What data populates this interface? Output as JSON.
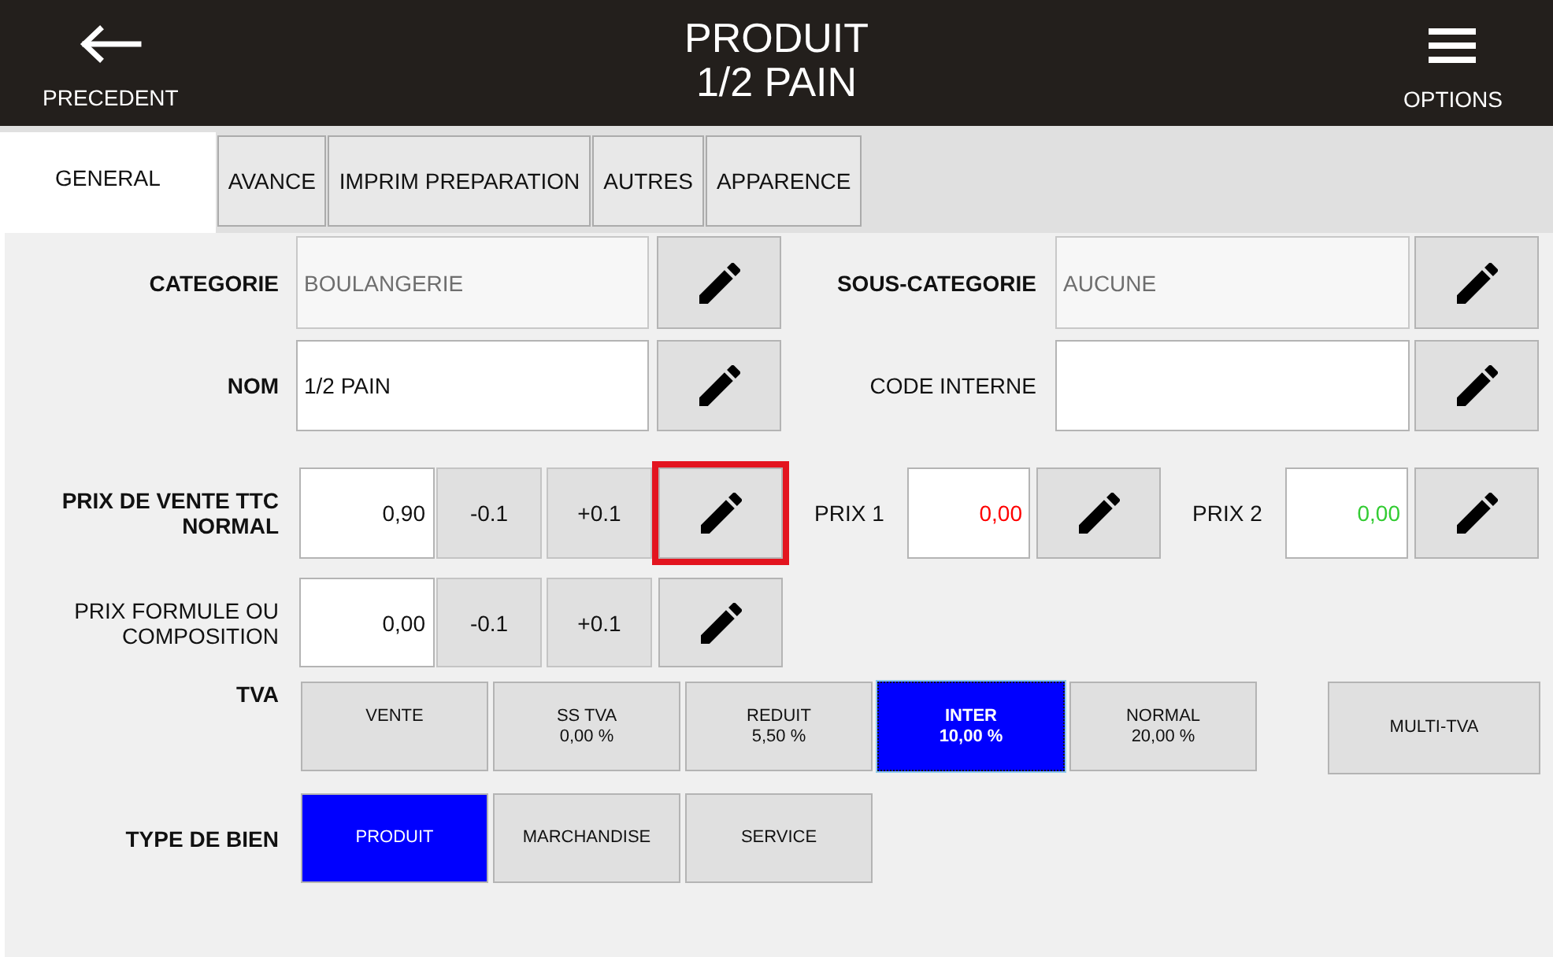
{
  "header": {
    "back_label": "PRECEDENT",
    "title": "PRODUIT",
    "subtitle": "1/2 PAIN",
    "options_label": "OPTIONS"
  },
  "tabs": [
    {
      "label": "GENERAL",
      "selected": true
    },
    {
      "label": "AVANCE",
      "selected": false
    },
    {
      "label": "IMPRIM PREPARATION",
      "selected": false
    },
    {
      "label": "AUTRES",
      "selected": false
    },
    {
      "label": "APPARENCE",
      "selected": false
    }
  ],
  "rows": [
    {
      "kind": "fields",
      "items": [
        {
          "label": "CATEGORIE",
          "bold": true,
          "value": "BOULANGERIE",
          "readonly": true
        },
        {
          "label": "SOUS-CATEGORIE",
          "bold": true,
          "value": "AUCUNE",
          "readonly": true
        }
      ]
    },
    {
      "kind": "fields",
      "items": [
        {
          "label": "NOM",
          "bold": true,
          "value": "1/2 PAIN",
          "readonly": false
        },
        {
          "label": "CODE INTERNE",
          "bold": false,
          "readonly": false
        }
      ]
    },
    {
      "kind": "price",
      "label": "PRIX DE VENTE TTC NORMAL",
      "bold": true,
      "value": "0,90",
      "steps": [
        "-0.1",
        "+0.1"
      ],
      "highlighted": true,
      "extras": [
        {
          "label": "PRIX 1",
          "value": "0,00",
          "color": "#ff0000"
        },
        {
          "label": "PRIX 2",
          "value": "0,00",
          "color": "#33cc33"
        }
      ]
    },
    {
      "kind": "price",
      "label": "PRIX FORMULE OU COMPOSITION",
      "bold": false,
      "value": "0,00",
      "steps": [
        "-0.1",
        "+0.1"
      ],
      "highlighted": false
    },
    {
      "kind": "rates",
      "label": "TVA",
      "bold": true,
      "options": [
        {
          "name": "VENTE",
          "selected": false,
          "focused": false
        },
        {
          "name": "SS TVA",
          "rate": "0,00 %",
          "selected": false,
          "focused": false
        },
        {
          "name": "REDUIT",
          "rate": "5,50 %",
          "selected": false,
          "focused": false
        },
        {
          "name": "INTER",
          "rate": "10,00 %",
          "selected": true,
          "focused": true
        },
        {
          "name": "NORMAL",
          "rate": "20,00 %",
          "selected": false,
          "focused": false
        }
      ],
      "extra": "MULTI-TVA"
    },
    {
      "kind": "choice",
      "label": "TYPE DE BIEN",
      "bold": true,
      "options": [
        {
          "name": "PRODUIT",
          "selected": true
        },
        {
          "name": "MARCHANDISE",
          "selected": false
        },
        {
          "name": "SERVICE",
          "selected": false
        }
      ]
    }
  ]
}
